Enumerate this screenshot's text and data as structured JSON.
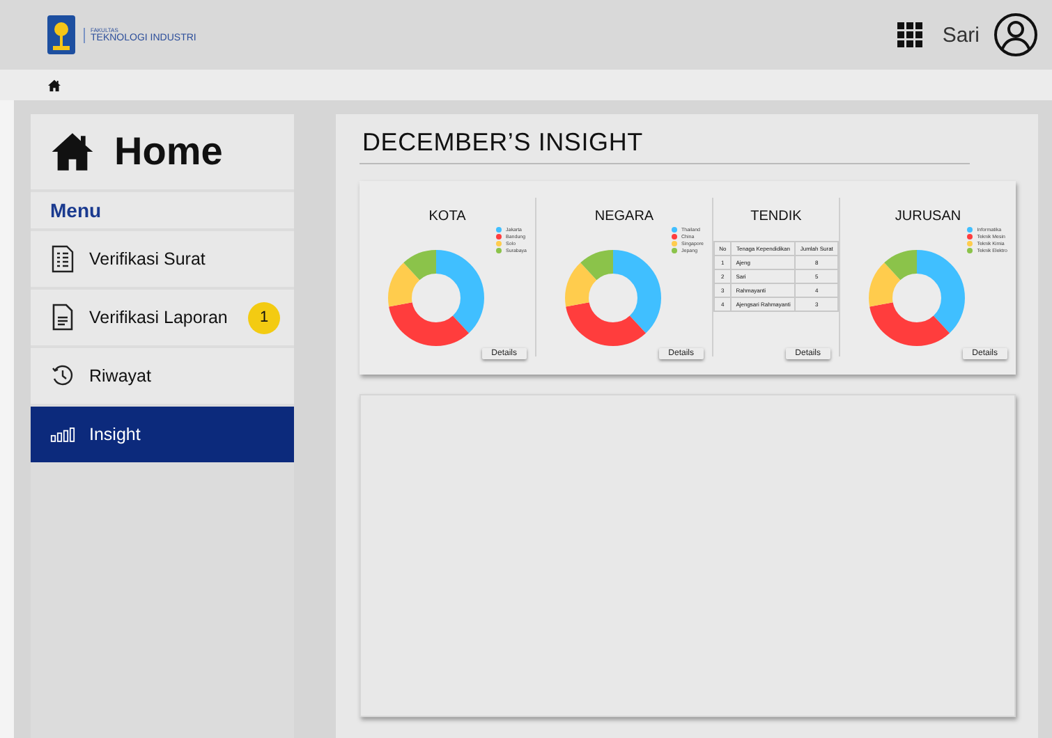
{
  "header": {
    "faculty_small": "FAKULTAS",
    "faculty": "TEKNOLOGI INDUSTRI",
    "user": "Sari"
  },
  "sidebar": {
    "title": "Home",
    "menu_label": "Menu",
    "items": [
      {
        "label": "Verifikasi Surat",
        "kind": "list",
        "selected": false
      },
      {
        "label": "Verifikasi Laporan",
        "kind": "doc",
        "badge": "1",
        "selected": false
      },
      {
        "label": "Riwayat",
        "kind": "history",
        "selected": false
      },
      {
        "label": "Insight",
        "kind": "chart",
        "selected": true
      }
    ]
  },
  "page_title": "DECEMBER’S INSIGHT",
  "cards": [
    {
      "kind": "donut",
      "title": "KOTA",
      "legend": [
        {
          "label": "Jakarta",
          "color": "#40bfff"
        },
        {
          "label": "Bandung",
          "color": "#ff3d3d"
        },
        {
          "label": "Solo",
          "color": "#ffcc4d"
        },
        {
          "label": "Surabaya",
          "color": "#8bc34a"
        }
      ],
      "button": "Details"
    },
    {
      "kind": "donut",
      "title": "NEGARA",
      "legend": [
        {
          "label": "Thailand",
          "color": "#40bfff"
        },
        {
          "label": "China",
          "color": "#ff3d3d"
        },
        {
          "label": "Singapore",
          "color": "#ffcc4d"
        },
        {
          "label": "Jepang",
          "color": "#8bc34a"
        }
      ],
      "button": "Details"
    },
    {
      "kind": "table",
      "title": "TENDIK",
      "columns": [
        "No",
        "Tenaga Kependidikan",
        "Jumlah Surat"
      ],
      "rows": [
        [
          "1",
          "Ajeng",
          "8"
        ],
        [
          "2",
          "Sari",
          "5"
        ],
        [
          "3",
          "Rahmayanti",
          "4"
        ],
        [
          "4",
          "Ajengsari Rahmayanti",
          "3"
        ]
      ],
      "button": "Details"
    },
    {
      "kind": "donut",
      "title": "JURUSAN",
      "legend": [
        {
          "label": "Informatika",
          "color": "#40bfff"
        },
        {
          "label": "Teknik Mesin",
          "color": "#ff3d3d"
        },
        {
          "label": "Teknik Kimia",
          "color": "#ffcc4d"
        },
        {
          "label": "Teknik Elektro",
          "color": "#8bc34a"
        }
      ],
      "button": "Details"
    }
  ]
}
